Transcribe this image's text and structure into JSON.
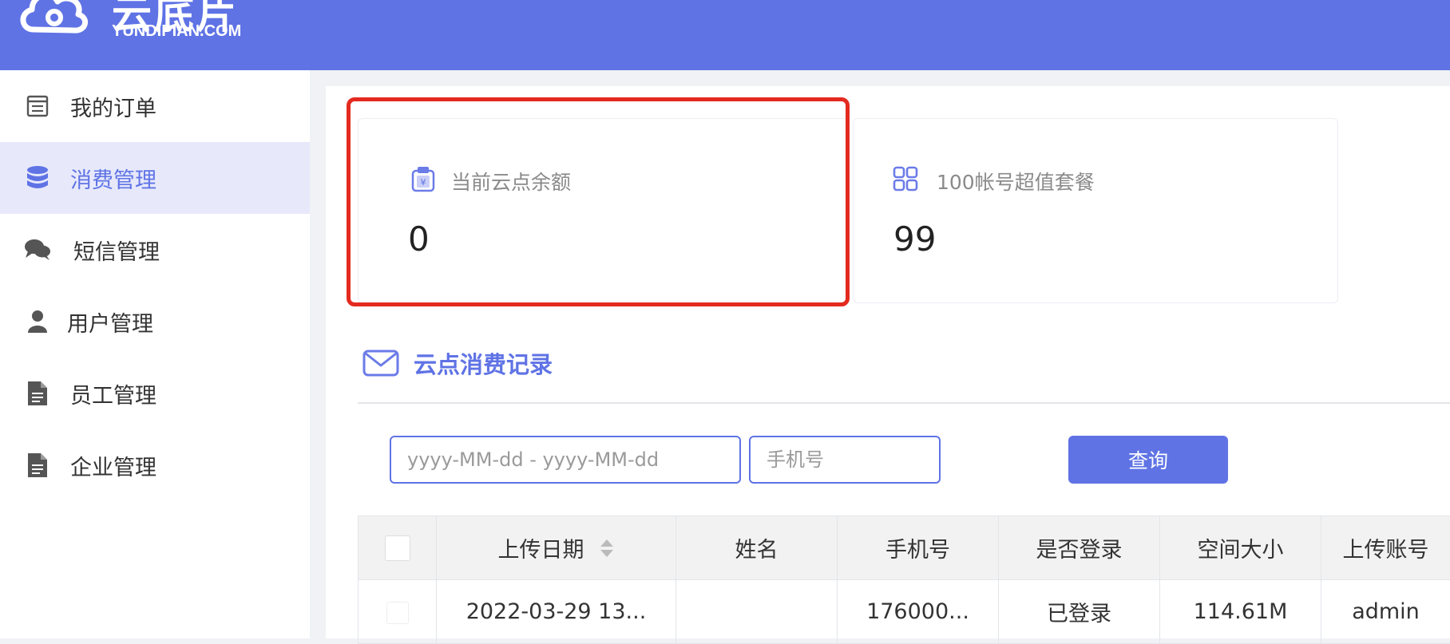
{
  "header": {
    "brand_cn": "云底片",
    "brand_en": "YUNDIPIAN.COM"
  },
  "sidebar": {
    "items": [
      {
        "label": "我的订单",
        "icon": "order-list-icon",
        "active": false
      },
      {
        "label": "消费管理",
        "icon": "database-icon",
        "active": true
      },
      {
        "label": "短信管理",
        "icon": "chat-bubbles-icon",
        "active": false
      },
      {
        "label": "用户管理",
        "icon": "user-icon",
        "active": false
      },
      {
        "label": "员工管理",
        "icon": "document-icon",
        "active": false
      },
      {
        "label": "企业管理",
        "icon": "document-icon",
        "active": false
      }
    ]
  },
  "cards": {
    "balance": {
      "title": "当前云点余额",
      "value": "0",
      "icon": "wallet-yen-icon"
    },
    "package": {
      "title": "100帐号超值套餐",
      "value": "99",
      "icon": "grid-apps-icon"
    }
  },
  "section": {
    "title": "云点消费记录",
    "icon": "mail-icon"
  },
  "filters": {
    "date_placeholder": "yyyy-MM-dd - yyyy-MM-dd",
    "phone_placeholder": "手机号",
    "query_label": "查询"
  },
  "table": {
    "columns": [
      "上传日期",
      "姓名",
      "手机号",
      "是否登录",
      "空间大小",
      "上传账号"
    ],
    "rows": [
      {
        "date": "2022-03-29 13...",
        "name": "",
        "phone": "176000...",
        "logged_in": "已登录",
        "size": "114.61M",
        "account": "admin"
      }
    ]
  },
  "colors": {
    "brand": "#5f73e5",
    "highlight": "#e42a1f"
  }
}
